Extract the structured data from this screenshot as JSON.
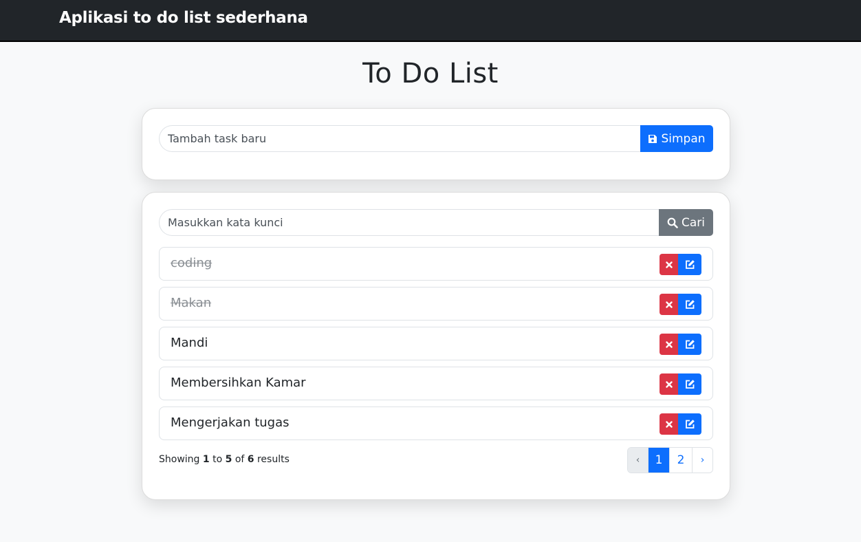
{
  "navbar": {
    "brand": "Aplikasi to do list sederhana"
  },
  "page": {
    "title": "To Do List"
  },
  "add_form": {
    "placeholder": "Tambah task baru",
    "save_label": "Simpan"
  },
  "search_form": {
    "placeholder": "Masukkan kata kunci",
    "search_label": "Cari"
  },
  "tasks": [
    {
      "label": "coding",
      "done": true
    },
    {
      "label": "Makan",
      "done": true
    },
    {
      "label": "Mandi",
      "done": false
    },
    {
      "label": "Membersihkan Kamar",
      "done": false
    },
    {
      "label": "Mengerjakan tugas",
      "done": false
    }
  ],
  "pagination_info": {
    "prefix": "Showing",
    "from": "1",
    "to_word": "to",
    "to": "5",
    "of_word": "of",
    "total": "6",
    "suffix": "results"
  },
  "pagination": {
    "prev": "‹",
    "pages": [
      "1",
      "2"
    ],
    "next": "›",
    "current": "1"
  },
  "colors": {
    "navbar": "#212529",
    "primary": "#0d6efd",
    "danger": "#dc3545",
    "secondary": "#6c757d"
  },
  "icons": {
    "save": "floppy-disk-icon",
    "search": "magnifier-icon",
    "delete": "x-icon",
    "edit": "pencil-square-icon"
  }
}
